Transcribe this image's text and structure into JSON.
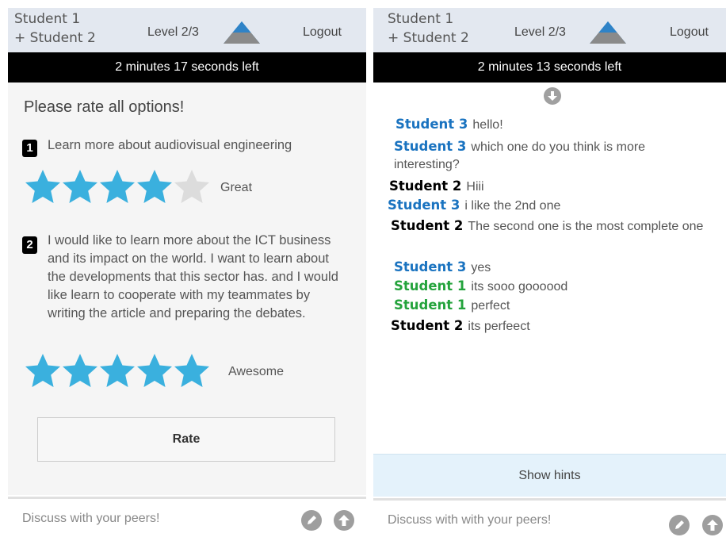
{
  "left": {
    "header": {
      "students": [
        "Student 1",
        "+ Student 2"
      ],
      "level": "Level 2/3",
      "logout": "Logout"
    },
    "timer": "2 minutes 17 seconds left",
    "rate_title": "Please rate all options!",
    "options": [
      {
        "number": "1",
        "text": "Learn more about audiovisual engineering",
        "rating": 4,
        "max_rating": 5,
        "rating_label": "Great"
      },
      {
        "number": "2",
        "text": "I would like to learn more about the ICT business and its impact on the world. I want to learn about the developments that this sector has. and I would like learn to cooperate with my teammates by writing the article and preparing the debates.",
        "rating": 5,
        "max_rating": 5,
        "rating_label": "Awesome"
      }
    ],
    "rate_button": "Rate",
    "footer_placeholder": "Discuss with your peers!"
  },
  "right": {
    "header": {
      "students": [
        "Student 1",
        "+ Student 2"
      ],
      "level": "Level 2/3",
      "logout": "Logout"
    },
    "timer": "2 minutes 13 seconds left",
    "messages": [
      {
        "sender": "Student 3",
        "text": "hello!",
        "color": "blue"
      },
      {
        "sender": "Student 3",
        "text": "which one do you think is more interesting?",
        "color": "blue"
      },
      {
        "sender": "Student 2",
        "text": "Hiii",
        "color": "black"
      },
      {
        "sender": "Student 3",
        "text": "i like the 2nd one",
        "color": "blue"
      },
      {
        "sender": "Student 2",
        "text": "The second one is the most complete one",
        "color": "black"
      },
      {
        "sender": "Student 3",
        "text": "yes",
        "color": "blue"
      },
      {
        "sender": "Student 1",
        "text": "its sooo goooood",
        "color": "green"
      },
      {
        "sender": "Student 1",
        "text": "perfect",
        "color": "green"
      },
      {
        "sender": "Student 2",
        "text": "its perfeect",
        "color": "black"
      }
    ],
    "hints_button": "Show hints",
    "footer_placeholder": "Discuss with with your peers!"
  },
  "colors": {
    "star_filled": "#3ab0de",
    "star_empty": "#dcdcdc",
    "header_bg": "#e3e8f0",
    "timer_bg": "#000000",
    "sender_blue": "#1a73c0",
    "sender_green": "#24a33c",
    "sender_black": "#000000",
    "hints_bg": "#e4f2fb"
  },
  "icons": [
    "level-triangle-icon",
    "star-icon",
    "pencil-icon",
    "arrow-up-icon",
    "arrow-down-icon"
  ]
}
